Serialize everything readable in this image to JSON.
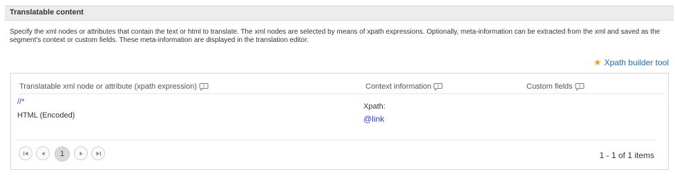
{
  "section": {
    "title": "Translatable content",
    "description": "Specify the xml nodes or attributes that contain the text or html to translate. The xml nodes are selected by means of xpath expressions. Optionally, meta-information can be extracted from the xml and saved as the segment's context or custom fields. These meta-information are displayed in the translation editor."
  },
  "builder_link": {
    "label": "Xpath builder tool",
    "icon": "star-icon",
    "icon_color": "#f0a020"
  },
  "grid": {
    "columns": [
      {
        "label": "Translatable xml node or attribute (xpath expression)"
      },
      {
        "label": "Context information"
      },
      {
        "label": "Custom fields"
      }
    ],
    "rows": [
      {
        "xpath": "//*",
        "format": "HTML (Encoded)",
        "context_label": "Xpath:",
        "context_value": "@link",
        "custom_fields": ""
      }
    ]
  },
  "pager": {
    "first_icon": "first-page-icon",
    "prev_icon": "prev-page-icon",
    "current_page": "1",
    "next_icon": "next-page-icon",
    "last_icon": "last-page-icon",
    "info": "1 - 1 of 1 items"
  },
  "colors": {
    "link": "#2a3fd6",
    "accent_link": "#1a6fb3",
    "header_bg": "#ececec"
  }
}
